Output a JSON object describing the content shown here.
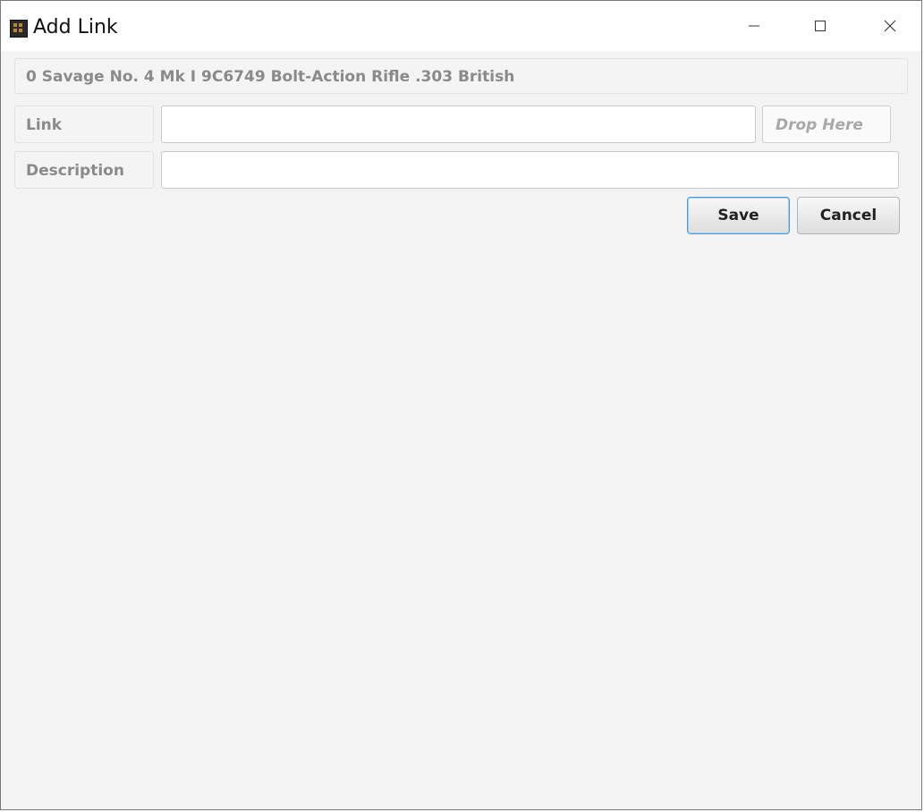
{
  "window": {
    "title": "Add Link",
    "app_icon": "nm-app-icon",
    "controls": {
      "minimize_icon": "minimize-icon",
      "maximize_icon": "maximize-icon",
      "close_icon": "close-icon"
    }
  },
  "item": {
    "header": "0 Savage  No. 4 Mk I 9C6749 Bolt-Action Rifle .303 British"
  },
  "form": {
    "link_label": "Link",
    "link_value": "",
    "drop_label": "Drop Here",
    "description_label": "Description",
    "description_value": ""
  },
  "buttons": {
    "save_label": "Save",
    "cancel_label": "Cancel"
  },
  "colors": {
    "accent_border": "#4f9ad4",
    "window_bg": "#f3f3f3",
    "label_text": "#8a8a8a"
  }
}
